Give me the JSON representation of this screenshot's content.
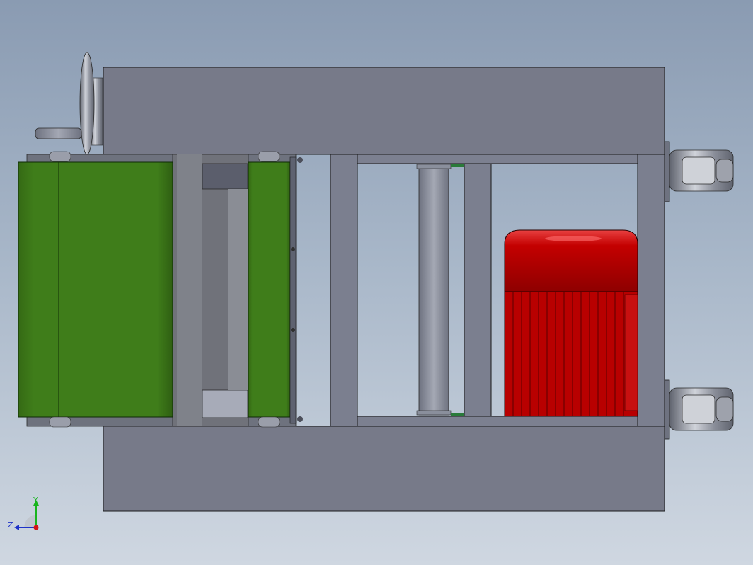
{
  "viewport": {
    "background_top": "#8a9bb2",
    "background_bottom": "#cfd7e1"
  },
  "model": {
    "frame_color": "#767a8a",
    "belt_color": "#3f7a1a",
    "motor_color": "#b40000",
    "shaft_color": "#8a8f9c"
  },
  "triad": {
    "x_label": "",
    "y_label": "Y",
    "z_label": "Z",
    "y_color": "#19b41e",
    "z_color": "#1e32c8",
    "origin_color": "#d21414"
  }
}
